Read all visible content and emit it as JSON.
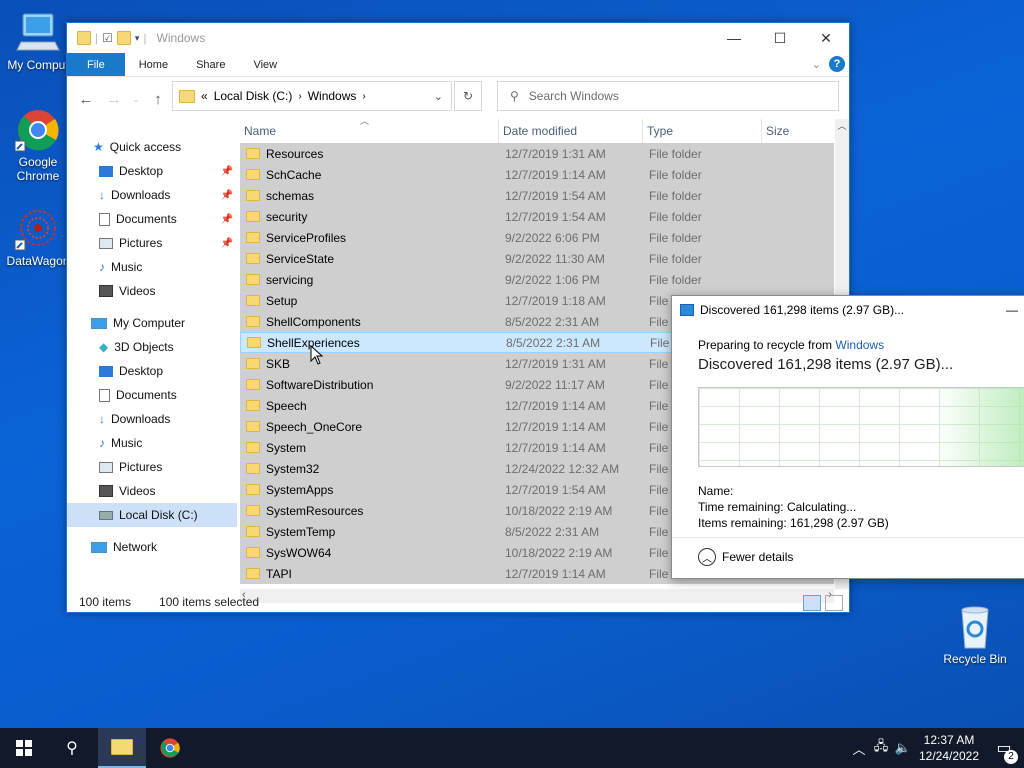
{
  "desktop": {
    "icons": [
      {
        "label": "My Comput",
        "icon": "computer-icon"
      },
      {
        "label": "Google Chrome",
        "icon": "chrome-icon"
      },
      {
        "label": "DataWagon",
        "icon": "datawagon-icon"
      },
      {
        "label": "Recycle Bin",
        "icon": "recycle-bin-icon"
      }
    ]
  },
  "explorer": {
    "title": "Windows",
    "ribbon_tabs": [
      "File",
      "Home",
      "Share",
      "View"
    ],
    "address": {
      "breadcrumb": [
        "Local Disk (C:)",
        "Windows"
      ],
      "prefix": "«"
    },
    "search_placeholder": "Search Windows",
    "nav": {
      "quick_access": "Quick access",
      "quick_items": [
        "Desktop",
        "Downloads",
        "Documents",
        "Pictures",
        "Music",
        "Videos"
      ],
      "my_computer": "My Computer",
      "computer_items": [
        "3D Objects",
        "Desktop",
        "Documents",
        "Downloads",
        "Music",
        "Pictures",
        "Videos",
        "Local Disk (C:)"
      ],
      "network": "Network"
    },
    "columns": [
      "Name",
      "Date modified",
      "Type",
      "Size"
    ],
    "rows": [
      {
        "name": "Resources",
        "date": "12/7/2019 1:31 AM",
        "type": "File folder"
      },
      {
        "name": "SchCache",
        "date": "12/7/2019 1:14 AM",
        "type": "File folder"
      },
      {
        "name": "schemas",
        "date": "12/7/2019 1:54 AM",
        "type": "File folder"
      },
      {
        "name": "security",
        "date": "12/7/2019 1:54 AM",
        "type": "File folder"
      },
      {
        "name": "ServiceProfiles",
        "date": "9/2/2022 6:06 PM",
        "type": "File folder"
      },
      {
        "name": "ServiceState",
        "date": "9/2/2022 11:30 AM",
        "type": "File folder"
      },
      {
        "name": "servicing",
        "date": "9/2/2022 1:06 PM",
        "type": "File folder"
      },
      {
        "name": "Setup",
        "date": "12/7/2019 1:18 AM",
        "type": "File f"
      },
      {
        "name": "ShellComponents",
        "date": "8/5/2022 2:31 AM",
        "type": "File f"
      },
      {
        "name": "ShellExperiences",
        "date": "8/5/2022 2:31 AM",
        "type": "File f"
      },
      {
        "name": "SKB",
        "date": "12/7/2019 1:31 AM",
        "type": "File f"
      },
      {
        "name": "SoftwareDistribution",
        "date": "9/2/2022 11:17 AM",
        "type": "File f"
      },
      {
        "name": "Speech",
        "date": "12/7/2019 1:14 AM",
        "type": "File f"
      },
      {
        "name": "Speech_OneCore",
        "date": "12/7/2019 1:14 AM",
        "type": "File f"
      },
      {
        "name": "System",
        "date": "12/7/2019 1:14 AM",
        "type": "File f"
      },
      {
        "name": "System32",
        "date": "12/24/2022 12:32 AM",
        "type": "File f"
      },
      {
        "name": "SystemApps",
        "date": "12/7/2019 1:54 AM",
        "type": "File f"
      },
      {
        "name": "SystemResources",
        "date": "10/18/2022 2:19 AM",
        "type": "File f"
      },
      {
        "name": "SystemTemp",
        "date": "8/5/2022 2:31 AM",
        "type": "File f"
      },
      {
        "name": "SysWOW64",
        "date": "10/18/2022 2:19 AM",
        "type": "File f"
      },
      {
        "name": "TAPI",
        "date": "12/7/2019 1:14 AM",
        "type": "File f"
      }
    ],
    "status": {
      "count": "100 items",
      "selected": "100 items selected"
    }
  },
  "dialog": {
    "title": "Discovered 161,298 items (2.97 GB)...",
    "preparing_prefix": "Preparing to recycle from",
    "preparing_link": "Windows",
    "headline": "Discovered 161,298 items (2.97 GB)...",
    "name_label": "Name:",
    "time_label": "Time remaining:",
    "time_value": "Calculating...",
    "items_label": "Items remaining:",
    "items_value": "161,298 (2.97 GB)",
    "fewer_details": "Fewer details"
  },
  "taskbar": {
    "time": "12:37 AM",
    "date": "12/24/2022",
    "notifications": "2"
  },
  "colors": {
    "accent": "#1979ca",
    "selection": "#cce8ff",
    "taskbar": "#11192a"
  }
}
